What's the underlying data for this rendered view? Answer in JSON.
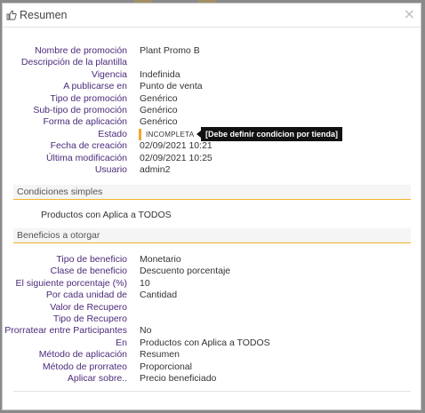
{
  "dialog": {
    "title": "Resumen",
    "close_label": "×"
  },
  "summary": [
    {
      "label": "Nombre de promoción",
      "value": "Plant Promo B"
    },
    {
      "label": "Descripción de la plantilla",
      "value": ""
    },
    {
      "label": "Vigencia",
      "value": "Indefinida"
    },
    {
      "label": "A publicarse en",
      "value": "Punto de venta"
    },
    {
      "label": "Tipo de promoción",
      "value": "Genérico"
    },
    {
      "label": "Sub-tipo de promoción",
      "value": "Genérico"
    },
    {
      "label": "Forma de aplicación",
      "value": "Genérico"
    },
    {
      "label": "Estado",
      "value": ""
    },
    {
      "label": "Fecha de creación",
      "value": "02/09/2021 10:21"
    },
    {
      "label": "Última modificación",
      "value": "02/09/2021 10:25"
    },
    {
      "label": "Usuario",
      "value": "admin2"
    }
  ],
  "status": {
    "badge": "INCOMPLETA",
    "tooltip": "[Debe definir condicion por tienda]",
    "badge_color": "#f0a830"
  },
  "simple_conditions": {
    "header": "Condiciones simples",
    "text": "Productos con Aplica a TODOS"
  },
  "benefits": {
    "header": "Beneficios a otorgar",
    "rows": [
      {
        "label": "Tipo de beneficio",
        "value": "Monetario"
      },
      {
        "label": "Clase de beneficio",
        "value": "Descuento porcentaje"
      },
      {
        "label": "El siguiente porcentaje (%)",
        "value": "10"
      },
      {
        "label": "Por cada unidad de",
        "value": "Cantidad"
      },
      {
        "label": "Valor de Recupero",
        "value": ""
      },
      {
        "label": "Tipo de Recupero",
        "value": ""
      },
      {
        "label": "Prorratear entre Participantes",
        "value": "No"
      },
      {
        "label": "En",
        "value": "Productos con Aplica a TODOS"
      },
      {
        "label": "Método de aplicación",
        "value": "Resumen"
      },
      {
        "label": "Método de prorrateo",
        "value": "Proporcional"
      },
      {
        "label": "Aplicar sobre..",
        "value": "Precio beneficiado"
      }
    ]
  },
  "colors": {
    "label": "#4b2b7a",
    "accent": "#f0b429"
  },
  "icons": {
    "title_icon": "thumbs-up-icon",
    "close_icon": "close-icon"
  }
}
